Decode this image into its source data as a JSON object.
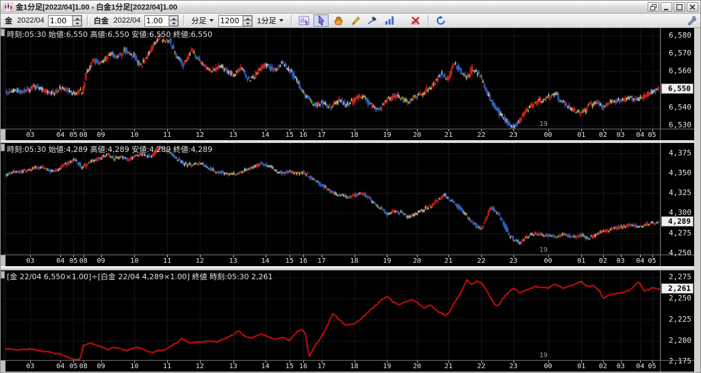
{
  "window": {
    "title": "金1分足[2022/04]1.00 - 白金1分足[2022/04]1.00"
  },
  "toolbar": {
    "gold_label": "金",
    "gold_month": "2022/04",
    "gold_scale": "1.00",
    "platinum_label": "白金",
    "platinum_month": "2022/04",
    "platinum_scale": "1.00",
    "period_label": "分足",
    "bars_value": "1200",
    "interval_label": "1分足",
    "icons": {
      "title": "candlestick-mini-chart",
      "window": [
        "cascade",
        "minimize",
        "maximize",
        "close"
      ],
      "tools": [
        "chart-cursor",
        "select-arrow",
        "hand-pan",
        "pencil-draw",
        "pen-annotate",
        "bar-chart-type",
        "delete-chart",
        "refresh"
      ],
      "right": "wrench-settings"
    }
  },
  "time_axis": {
    "labels": [
      "03",
      "04",
      "05",
      "08",
      "09",
      "10",
      "11",
      "12",
      "13",
      "14",
      "15",
      "16",
      "17",
      "18",
      "19",
      "20",
      "21",
      "22",
      "23",
      "00",
      "01",
      "02",
      "03",
      "04",
      "05"
    ],
    "positions": [
      0.038,
      0.084,
      0.104,
      0.119,
      0.146,
      0.197,
      0.247,
      0.297,
      0.348,
      0.397,
      0.434,
      0.455,
      0.483,
      0.533,
      0.583,
      0.629,
      0.677,
      0.727,
      0.776,
      0.829,
      0.88,
      0.913,
      0.94,
      0.97,
      0.988
    ],
    "date_marker": {
      "label": "19",
      "position": 0.822
    }
  },
  "chart_data": [
    {
      "type": "candlestick",
      "name": "gold-1min",
      "info_line": "時刻:05:30 始値:6,550 高値:6,550 安値:6,550 終値:6,550",
      "y_ticks": [
        "6,580",
        "6,570",
        "6,560",
        "6,550",
        "6,540",
        "6,530"
      ],
      "y_tick_values": [
        6580,
        6570,
        6560,
        6550,
        6540,
        6530
      ],
      "ylim": [
        6528,
        6584
      ],
      "current_price": 6550,
      "current_price_label": "6,550",
      "up_color": "#f5281e",
      "down_color": "#3a76e8",
      "flat_color": "#f0e878",
      "noise": 1.7,
      "path": [
        [
          0.0,
          6548
        ],
        [
          0.03,
          6549
        ],
        [
          0.045,
          6552
        ],
        [
          0.06,
          6549
        ],
        [
          0.075,
          6548
        ],
        [
          0.085,
          6551
        ],
        [
          0.095,
          6549
        ],
        [
          0.105,
          6548
        ],
        [
          0.118,
          6549
        ],
        [
          0.124,
          6560
        ],
        [
          0.135,
          6566
        ],
        [
          0.146,
          6564
        ],
        [
          0.16,
          6570
        ],
        [
          0.17,
          6567
        ],
        [
          0.182,
          6572
        ],
        [
          0.197,
          6568
        ],
        [
          0.207,
          6563
        ],
        [
          0.222,
          6572
        ],
        [
          0.235,
          6580
        ],
        [
          0.242,
          6576
        ],
        [
          0.25,
          6578
        ],
        [
          0.262,
          6568
        ],
        [
          0.272,
          6563
        ],
        [
          0.285,
          6572
        ],
        [
          0.297,
          6565
        ],
        [
          0.312,
          6560
        ],
        [
          0.33,
          6563
        ],
        [
          0.348,
          6558
        ],
        [
          0.36,
          6562
        ],
        [
          0.372,
          6555
        ],
        [
          0.385,
          6559
        ],
        [
          0.397,
          6564
        ],
        [
          0.41,
          6560
        ],
        [
          0.422,
          6565
        ],
        [
          0.434,
          6560
        ],
        [
          0.444,
          6556
        ],
        [
          0.455,
          6548
        ],
        [
          0.465,
          6544
        ],
        [
          0.475,
          6541
        ],
        [
          0.483,
          6543
        ],
        [
          0.498,
          6540
        ],
        [
          0.51,
          6544
        ],
        [
          0.522,
          6541
        ],
        [
          0.533,
          6544
        ],
        [
          0.545,
          6547
        ],
        [
          0.558,
          6541
        ],
        [
          0.57,
          6538
        ],
        [
          0.583,
          6544
        ],
        [
          0.598,
          6546
        ],
        [
          0.612,
          6543
        ],
        [
          0.629,
          6546
        ],
        [
          0.642,
          6549
        ],
        [
          0.655,
          6553
        ],
        [
          0.665,
          6558
        ],
        [
          0.677,
          6556
        ],
        [
          0.686,
          6565
        ],
        [
          0.695,
          6560
        ],
        [
          0.705,
          6556
        ],
        [
          0.714,
          6562
        ],
        [
          0.727,
          6556
        ],
        [
          0.737,
          6547
        ],
        [
          0.748,
          6540
        ],
        [
          0.76,
          6534
        ],
        [
          0.776,
          6528
        ],
        [
          0.786,
          6533
        ],
        [
          0.8,
          6540
        ],
        [
          0.812,
          6543
        ],
        [
          0.829,
          6545
        ],
        [
          0.84,
          6548
        ],
        [
          0.852,
          6542
        ],
        [
          0.865,
          6539
        ],
        [
          0.88,
          6536
        ],
        [
          0.892,
          6541
        ],
        [
          0.903,
          6543
        ],
        [
          0.913,
          6540
        ],
        [
          0.926,
          6543
        ],
        [
          0.94,
          6544
        ],
        [
          0.955,
          6545
        ],
        [
          0.97,
          6544
        ],
        [
          0.98,
          6547
        ],
        [
          0.99,
          6549
        ],
        [
          1.0,
          6550
        ]
      ]
    },
    {
      "type": "candlestick",
      "name": "platinum-1min",
      "info_line": "時刻:05:30 始値:4,289 高値:4,289 安値:4,289 終値:4,289",
      "y_ticks": [
        "4,375",
        "4,350",
        "4,325",
        "4,300",
        "4,275",
        "4,250"
      ],
      "y_tick_values": [
        4375,
        4350,
        4325,
        4300,
        4275,
        4250
      ],
      "ylim": [
        4248,
        4388
      ],
      "current_price": 4289,
      "current_price_label": "4,289",
      "up_color": "#f5281e",
      "down_color": "#3a76e8",
      "flat_color": "#f0e878",
      "noise": 2.6,
      "path": [
        [
          0.0,
          4349
        ],
        [
          0.02,
          4352
        ],
        [
          0.038,
          4355
        ],
        [
          0.055,
          4358
        ],
        [
          0.07,
          4352
        ],
        [
          0.084,
          4357
        ],
        [
          0.095,
          4363
        ],
        [
          0.105,
          4368
        ],
        [
          0.118,
          4357
        ],
        [
          0.13,
          4365
        ],
        [
          0.146,
          4370
        ],
        [
          0.156,
          4374
        ],
        [
          0.166,
          4368
        ],
        [
          0.176,
          4372
        ],
        [
          0.186,
          4366
        ],
        [
          0.197,
          4372
        ],
        [
          0.21,
          4375
        ],
        [
          0.222,
          4370
        ],
        [
          0.235,
          4383
        ],
        [
          0.247,
          4378
        ],
        [
          0.26,
          4370
        ],
        [
          0.272,
          4362
        ],
        [
          0.285,
          4360
        ],
        [
          0.297,
          4363
        ],
        [
          0.31,
          4357
        ],
        [
          0.322,
          4352
        ],
        [
          0.335,
          4350
        ],
        [
          0.348,
          4348
        ],
        [
          0.362,
          4352
        ],
        [
          0.376,
          4357
        ],
        [
          0.39,
          4362
        ],
        [
          0.4,
          4360
        ],
        [
          0.412,
          4353
        ],
        [
          0.424,
          4350
        ],
        [
          0.434,
          4352
        ],
        [
          0.445,
          4350
        ],
        [
          0.455,
          4352
        ],
        [
          0.466,
          4345
        ],
        [
          0.476,
          4340
        ],
        [
          0.483,
          4335
        ],
        [
          0.495,
          4328
        ],
        [
          0.51,
          4322
        ],
        [
          0.522,
          4320
        ],
        [
          0.533,
          4322
        ],
        [
          0.545,
          4325
        ],
        [
          0.556,
          4318
        ],
        [
          0.566,
          4310
        ],
        [
          0.575,
          4305
        ],
        [
          0.583,
          4298
        ],
        [
          0.595,
          4303
        ],
        [
          0.606,
          4300
        ],
        [
          0.617,
          4295
        ],
        [
          0.629,
          4300
        ],
        [
          0.641,
          4305
        ],
        [
          0.652,
          4310
        ],
        [
          0.662,
          4318
        ],
        [
          0.67,
          4323
        ],
        [
          0.677,
          4318
        ],
        [
          0.69,
          4310
        ],
        [
          0.701,
          4300
        ],
        [
          0.712,
          4290
        ],
        [
          0.72,
          4284
        ],
        [
          0.727,
          4280
        ],
        [
          0.735,
          4294
        ],
        [
          0.742,
          4308
        ],
        [
          0.752,
          4300
        ],
        [
          0.762,
          4286
        ],
        [
          0.77,
          4272
        ],
        [
          0.776,
          4268
        ],
        [
          0.786,
          4263
        ],
        [
          0.796,
          4270
        ],
        [
          0.81,
          4275
        ],
        [
          0.829,
          4272
        ],
        [
          0.841,
          4270
        ],
        [
          0.852,
          4274
        ],
        [
          0.863,
          4270
        ],
        [
          0.88,
          4272
        ],
        [
          0.891,
          4268
        ],
        [
          0.902,
          4273
        ],
        [
          0.913,
          4277
        ],
        [
          0.926,
          4280
        ],
        [
          0.94,
          4282
        ],
        [
          0.955,
          4285
        ],
        [
          0.97,
          4283
        ],
        [
          0.98,
          4286
        ],
        [
          0.99,
          4288
        ],
        [
          1.0,
          4289
        ]
      ]
    },
    {
      "type": "line",
      "name": "gold-platinum-ratio",
      "info_line": "[金 22/04 6,550×1.00]÷[白金 22/04 4,289×1.00] 終値 時刻:05:30 2,261",
      "y_ticks": [
        "2,275",
        "2,250",
        "2,225",
        "2,200",
        "2,175"
      ],
      "y_tick_values": [
        2275,
        2250,
        2225,
        2200,
        2175
      ],
      "ylim": [
        2177,
        2283
      ],
      "current_price": 2261,
      "current_price_label": "2,261",
      "color": "#f01010",
      "noise": 1.4,
      "path": [
        [
          0.0,
          2190
        ],
        [
          0.02,
          2189
        ],
        [
          0.038,
          2190
        ],
        [
          0.052,
          2188
        ],
        [
          0.07,
          2186
        ],
        [
          0.084,
          2184
        ],
        [
          0.095,
          2180
        ],
        [
          0.105,
          2177
        ],
        [
          0.114,
          2178
        ],
        [
          0.119,
          2194
        ],
        [
          0.13,
          2197
        ],
        [
          0.146,
          2193
        ],
        [
          0.156,
          2189
        ],
        [
          0.166,
          2192
        ],
        [
          0.176,
          2190
        ],
        [
          0.186,
          2188
        ],
        [
          0.197,
          2192
        ],
        [
          0.21,
          2190
        ],
        [
          0.222,
          2186
        ],
        [
          0.235,
          2188
        ],
        [
          0.247,
          2190
        ],
        [
          0.26,
          2197
        ],
        [
          0.27,
          2202
        ],
        [
          0.282,
          2197
        ],
        [
          0.297,
          2198
        ],
        [
          0.31,
          2200
        ],
        [
          0.322,
          2198
        ],
        [
          0.335,
          2202
        ],
        [
          0.348,
          2207
        ],
        [
          0.356,
          2212
        ],
        [
          0.366,
          2205
        ],
        [
          0.376,
          2203
        ],
        [
          0.39,
          2208
        ],
        [
          0.4,
          2205
        ],
        [
          0.412,
          2201
        ],
        [
          0.424,
          2204
        ],
        [
          0.434,
          2200
        ],
        [
          0.445,
          2210
        ],
        [
          0.452,
          2213
        ],
        [
          0.458,
          2209
        ],
        [
          0.464,
          2181
        ],
        [
          0.47,
          2190
        ],
        [
          0.483,
          2205
        ],
        [
          0.492,
          2218
        ],
        [
          0.5,
          2232
        ],
        [
          0.51,
          2225
        ],
        [
          0.52,
          2218
        ],
        [
          0.533,
          2220
        ],
        [
          0.545,
          2227
        ],
        [
          0.556,
          2235
        ],
        [
          0.566,
          2242
        ],
        [
          0.575,
          2248
        ],
        [
          0.583,
          2252
        ],
        [
          0.592,
          2246
        ],
        [
          0.602,
          2242
        ],
        [
          0.612,
          2246
        ],
        [
          0.62,
          2248
        ],
        [
          0.629,
          2245
        ],
        [
          0.64,
          2238
        ],
        [
          0.65,
          2242
        ],
        [
          0.66,
          2235
        ],
        [
          0.67,
          2230
        ],
        [
          0.677,
          2232
        ],
        [
          0.686,
          2245
        ],
        [
          0.695,
          2255
        ],
        [
          0.705,
          2272
        ],
        [
          0.712,
          2266
        ],
        [
          0.72,
          2270
        ],
        [
          0.727,
          2268
        ],
        [
          0.736,
          2258
        ],
        [
          0.745,
          2245
        ],
        [
          0.752,
          2240
        ],
        [
          0.762,
          2252
        ],
        [
          0.77,
          2258
        ],
        [
          0.776,
          2262
        ],
        [
          0.786,
          2256
        ],
        [
          0.796,
          2260
        ],
        [
          0.81,
          2264
        ],
        [
          0.829,
          2262
        ],
        [
          0.84,
          2267
        ],
        [
          0.851,
          2262
        ],
        [
          0.862,
          2264
        ],
        [
          0.88,
          2270
        ],
        [
          0.888,
          2264
        ],
        [
          0.9,
          2265
        ],
        [
          0.908,
          2258
        ],
        [
          0.913,
          2250
        ],
        [
          0.922,
          2254
        ],
        [
          0.94,
          2256
        ],
        [
          0.955,
          2260
        ],
        [
          0.968,
          2270
        ],
        [
          0.976,
          2258
        ],
        [
          0.988,
          2262
        ],
        [
          1.0,
          2261
        ]
      ]
    }
  ]
}
